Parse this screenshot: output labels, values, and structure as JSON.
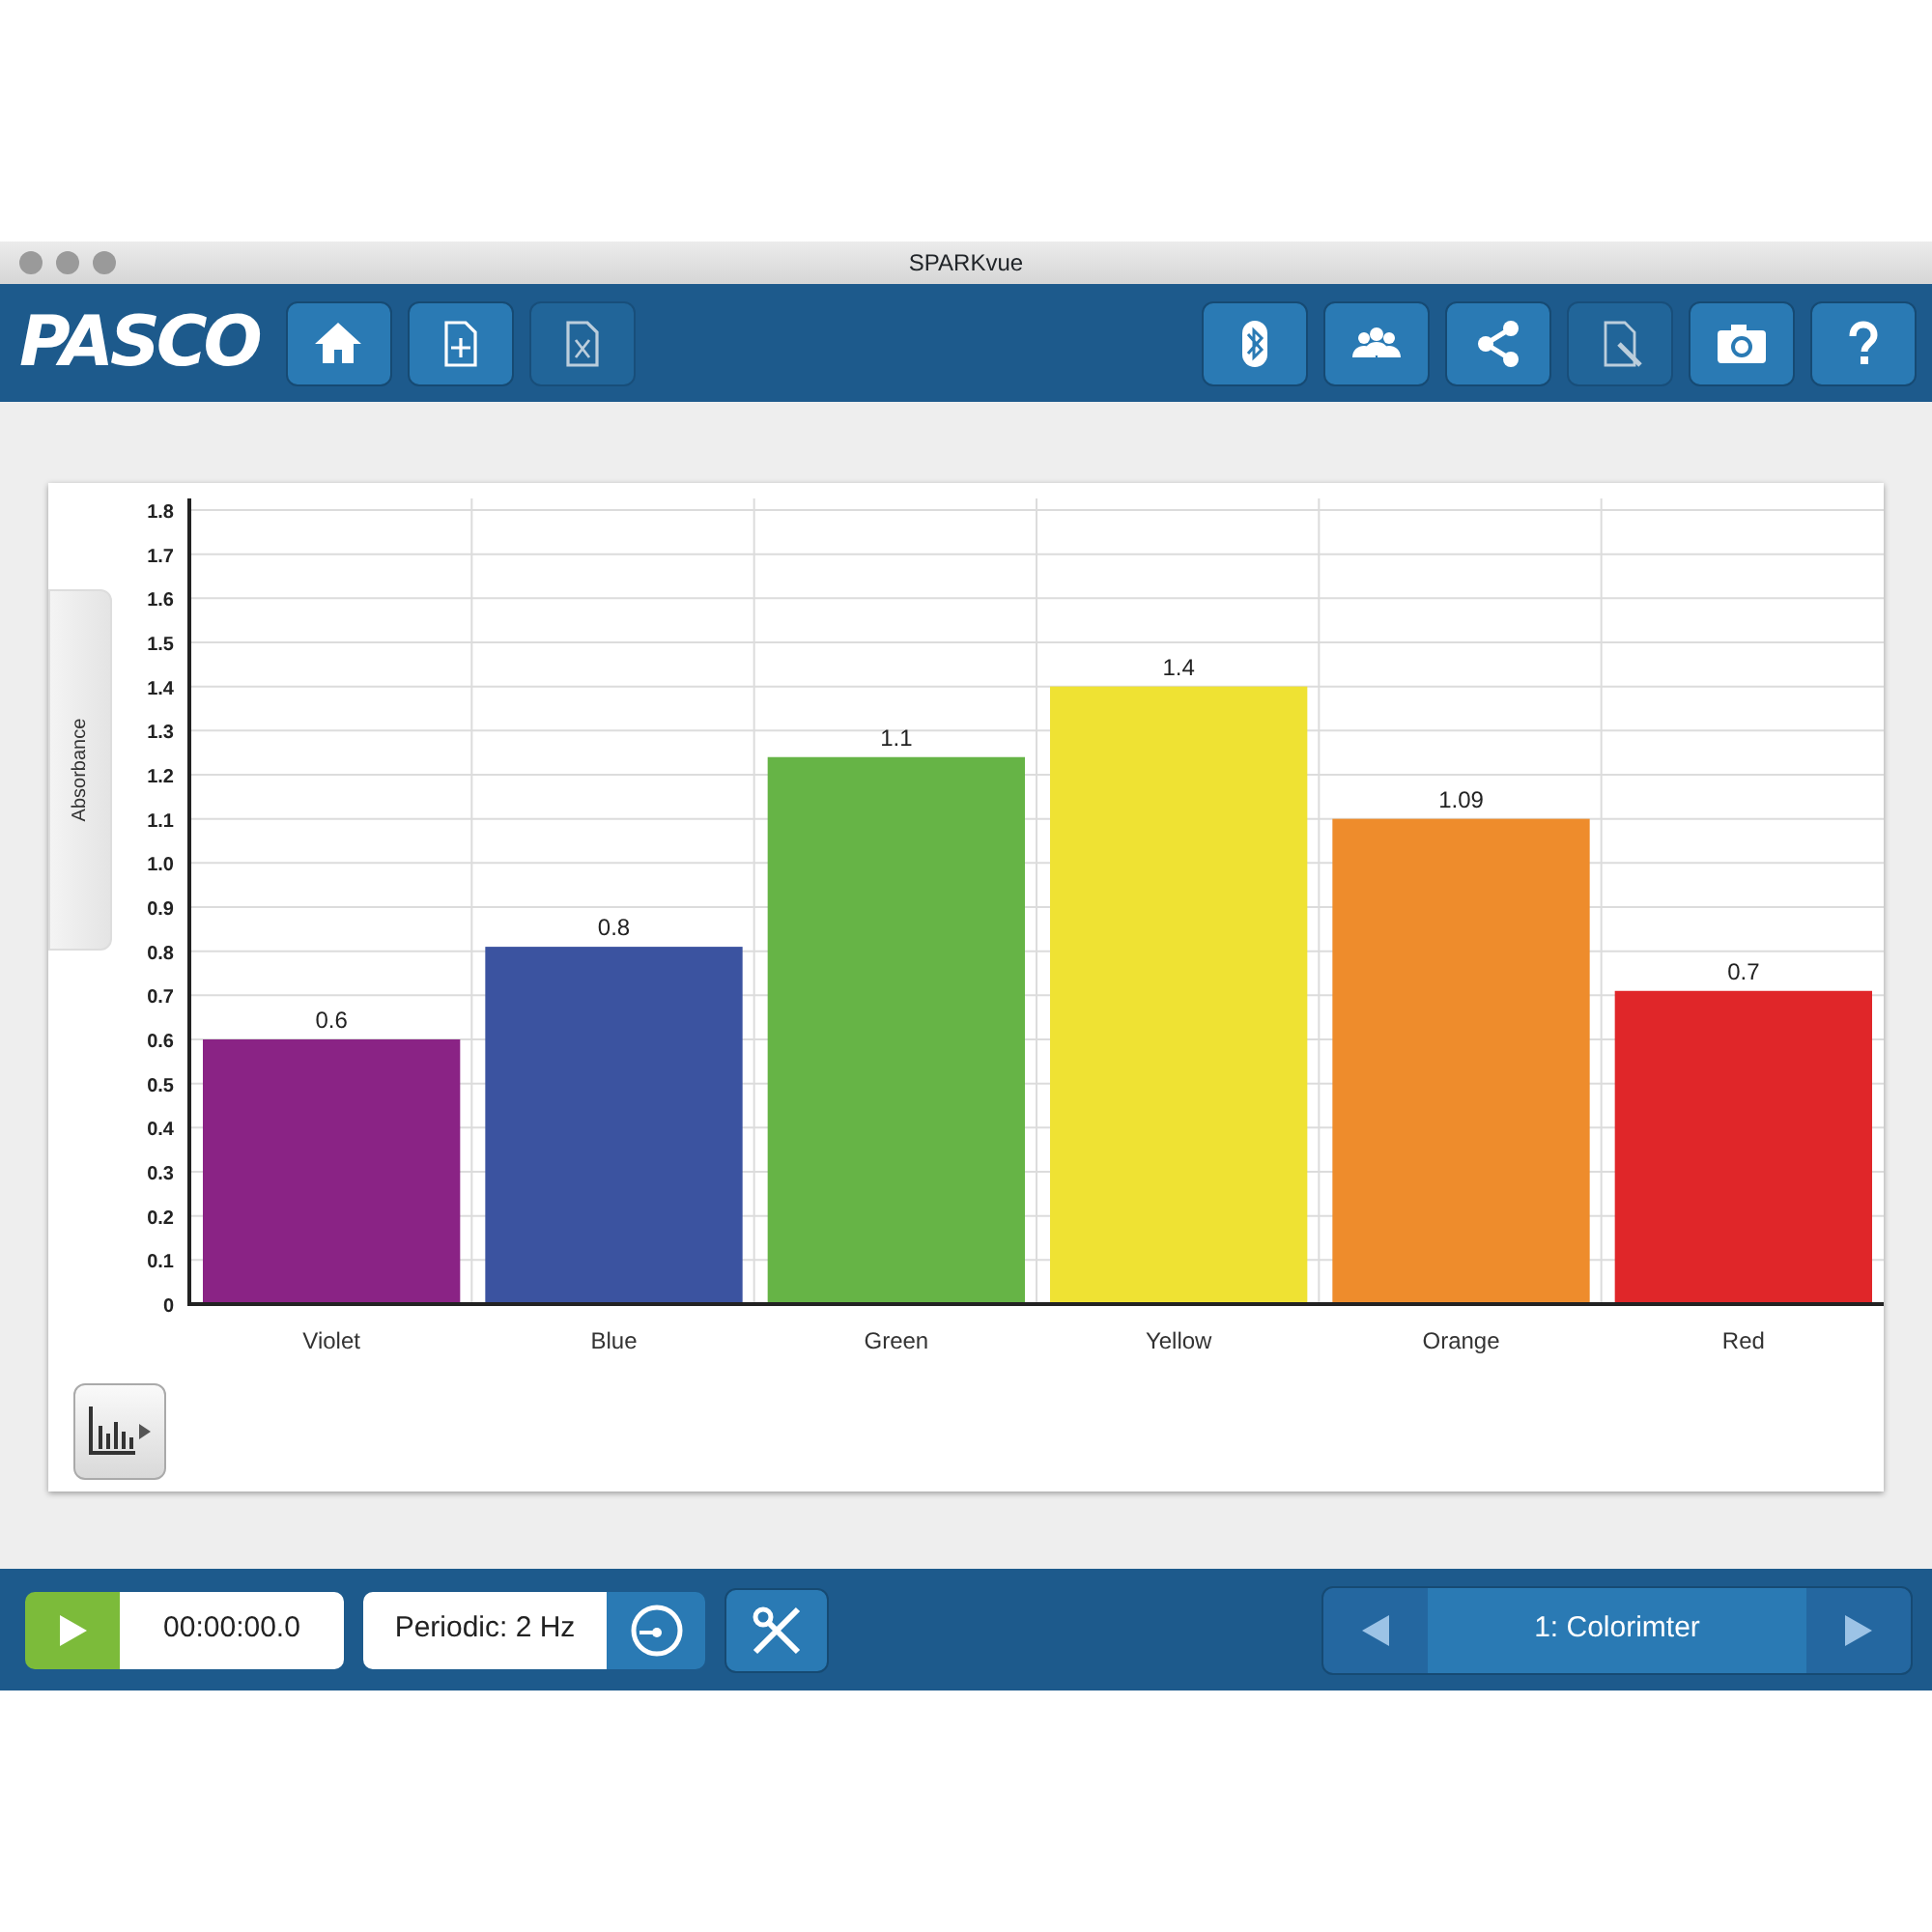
{
  "window": {
    "title": "SPARKvue"
  },
  "logo": "PASCO",
  "toolbar": {
    "left": [
      {
        "kind": "home",
        "disabled": false
      },
      {
        "kind": "new",
        "disabled": false
      },
      {
        "kind": "delete",
        "disabled": true
      }
    ],
    "right": [
      {
        "kind": "bluetooth",
        "disabled": false
      },
      {
        "kind": "group",
        "disabled": false
      },
      {
        "kind": "share",
        "disabled": false
      },
      {
        "kind": "journal",
        "disabled": true
      },
      {
        "kind": "camera",
        "disabled": false
      },
      {
        "kind": "help",
        "disabled": false
      }
    ]
  },
  "graph": {
    "chart_data": {
      "type": "bar",
      "ylabel": "Absorbance",
      "grid": true,
      "categories": [
        "Violet",
        "Blue",
        "Green",
        "Yellow",
        "Orange",
        "Red"
      ],
      "series": [
        {
          "values": [
            0.6,
            0.81,
            1.24,
            1.4,
            1.1,
            0.71
          ]
        }
      ],
      "colors": [
        "#8a2385",
        "#3b53a0",
        "#66b446",
        "#efe233",
        "#ee8c2c",
        "#e02629"
      ],
      "value_labels": [
        "0.6",
        "0.8",
        "1.1",
        "1.4",
        "1.09",
        "0.7"
      ],
      "ylim": [
        0,
        1.8
      ],
      "yticks": [
        {
          "value": 0,
          "label": "0"
        },
        {
          "value": 0.1,
          "label": "0.1"
        },
        {
          "value": 0.2,
          "label": "0.2"
        },
        {
          "value": 0.3,
          "label": "0.3"
        },
        {
          "value": 0.4,
          "label": "0.4"
        },
        {
          "value": 0.5,
          "label": "0.5"
        },
        {
          "value": 0.6,
          "label": "0.6"
        },
        {
          "value": 0.7,
          "label": "0.7"
        },
        {
          "value": 0.8,
          "label": "0.8"
        },
        {
          "value": 0.9,
          "label": "0.9"
        },
        {
          "value": 1.0,
          "label": "1.0"
        },
        {
          "value": 1.1,
          "label": "1.1"
        },
        {
          "value": 1.2,
          "label": "1.2"
        },
        {
          "value": 1.3,
          "label": "1.3"
        },
        {
          "value": 1.4,
          "label": "1.4"
        },
        {
          "value": 1.5,
          "label": "1.5"
        },
        {
          "value": 1.6,
          "label": "1.6"
        },
        {
          "value": 1.7,
          "label": "1.7"
        },
        {
          "value": 1.8,
          "label": "1.8"
        }
      ]
    }
  },
  "bottom_bar": {
    "time": "00:00:00.0",
    "sampling": "Periodic: 2 Hz",
    "page": "1: Colorimter"
  }
}
